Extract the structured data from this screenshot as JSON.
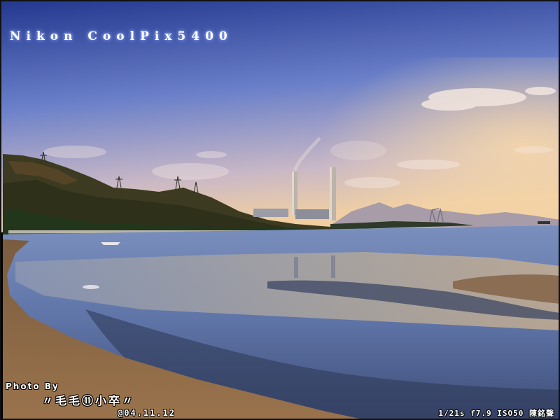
{
  "photo": {
    "camera_brand": "Nikon CoolPix5400",
    "photo_by": "Photo By",
    "photographer": "〃毛毛⑪小卒〃",
    "date": "@04.11.12",
    "exif": "1/21s f7.9 ISO50 陳銘聲"
  },
  "colors": {
    "sky_top": "#2a3f9a",
    "sky_mid": "#7a8fd0",
    "sky_horizon": "#e9c9a2",
    "hill": "#3b3a1f",
    "sea": "#6f86b8",
    "sand": "#8c6a48",
    "chimney": "#b8b0a8"
  }
}
